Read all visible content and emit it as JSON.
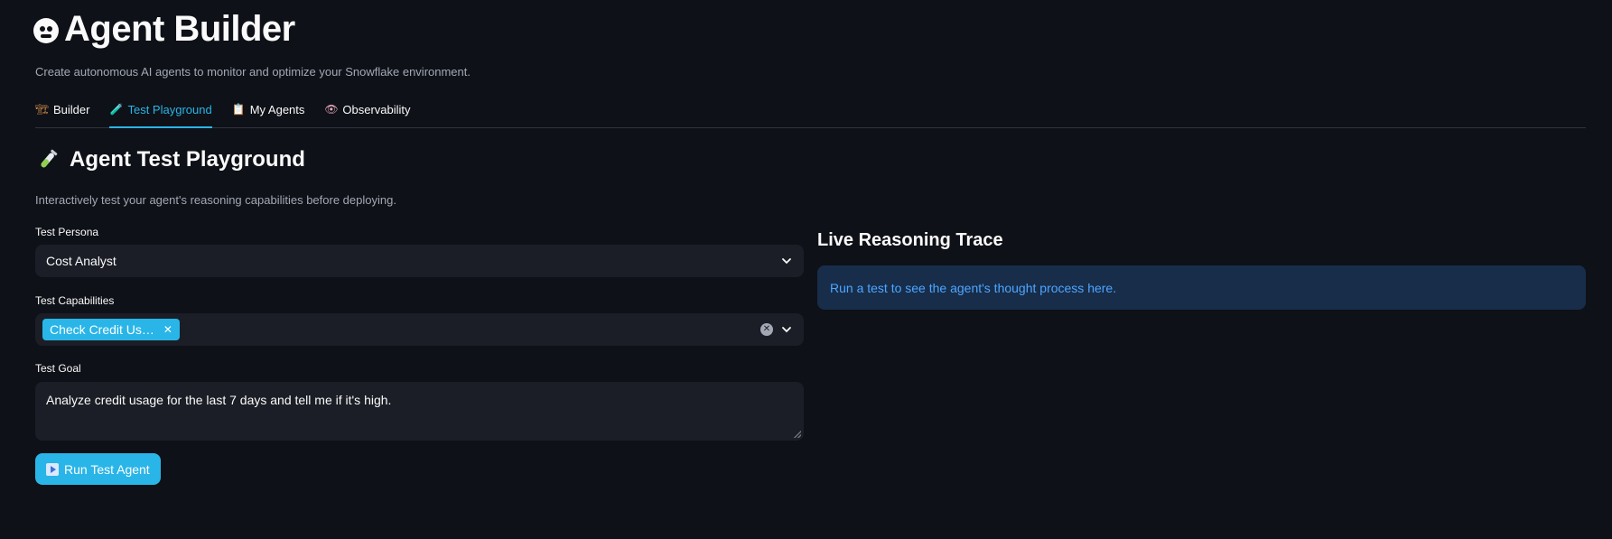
{
  "header": {
    "title": "Agent Builder",
    "title_icon": "robot-face-icon",
    "subtitle": "Create autonomous AI agents to monitor and optimize your Snowflake environment."
  },
  "tabs": [
    {
      "label": "Builder",
      "icon": "crane-icon",
      "active": false
    },
    {
      "label": "Test Playground",
      "icon": "test-tube-icon",
      "active": true
    },
    {
      "label": "My Agents",
      "icon": "clipboard-icon",
      "active": false
    },
    {
      "label": "Observability",
      "icon": "eye-icon",
      "active": false
    }
  ],
  "section": {
    "title": "Agent Test Playground",
    "title_icon": "test-tube-icon",
    "subtitle": "Interactively test your agent's reasoning capabilities before deploying."
  },
  "form": {
    "persona_label": "Test Persona",
    "persona_value": "Cost Analyst",
    "capabilities_label": "Test Capabilities",
    "capabilities_selected": [
      "Check Credit Us…"
    ],
    "goal_label": "Test Goal",
    "goal_value": "Analyze credit usage for the last 7 days and tell me if it's high.",
    "run_button_label": "Run Test Agent"
  },
  "trace": {
    "title": "Live Reasoning Trace",
    "info_message": "Run a test to see the agent's thought process here."
  },
  "colors": {
    "background": "#0e1117",
    "accent": "#29b5e8",
    "input_bg": "#1b1e26",
    "info_bg": "#172d4a",
    "info_text": "#4fa5ff"
  }
}
